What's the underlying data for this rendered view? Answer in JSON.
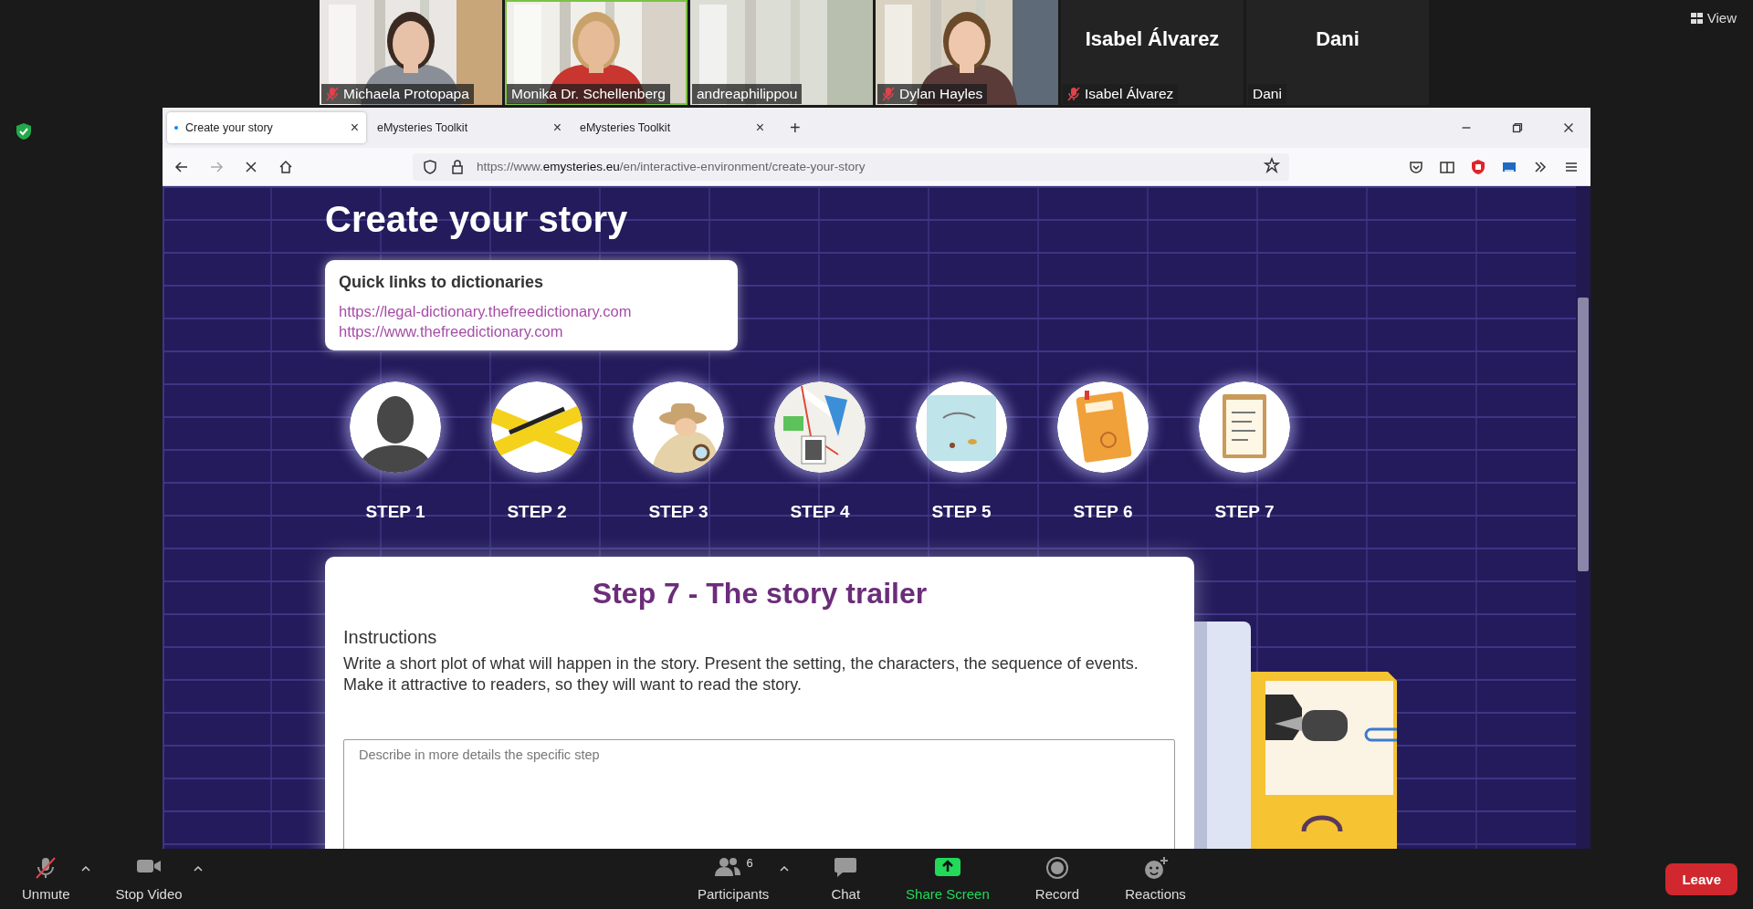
{
  "meeting": {
    "view_button": "View",
    "participants": [
      {
        "name": "Michaela Protopapa",
        "muted": true,
        "video": true,
        "speaking": false
      },
      {
        "name": "Monika Dr. Schellenberg",
        "muted": false,
        "video": true,
        "speaking": true
      },
      {
        "name": "andreaphilippou",
        "muted": false,
        "video": true,
        "speaking": false
      },
      {
        "name": "Dylan Hayles",
        "muted": true,
        "video": true,
        "speaking": false
      },
      {
        "name": "Isabel Álvarez",
        "display_name": "Isabel Álvarez",
        "muted": true,
        "video": false
      },
      {
        "name": "Dani",
        "display_name": "Dani",
        "muted": false,
        "video": false
      }
    ]
  },
  "browser": {
    "tabs": [
      {
        "label": "Create your story",
        "selected": true,
        "loading": true,
        "close": "×"
      },
      {
        "label": "eMysteries Toolkit",
        "selected": false,
        "loading": false,
        "close": "×"
      },
      {
        "label": "eMysteries Toolkit",
        "selected": false,
        "loading": false,
        "close": "×"
      }
    ],
    "new_tab": "+",
    "url": "https://www.**emysteries.eu**/en/interactive-environment/create-your-story",
    "page": {
      "title": "Create your story",
      "links_card": {
        "heading": "Quick links to dictionaries",
        "links": [
          "https://legal-dictionary.thefreedictionary.com",
          "https://www.thefreedictionary.com"
        ]
      },
      "steps": [
        {
          "label": "STEP 1"
        },
        {
          "label": "STEP 2"
        },
        {
          "label": "STEP 3"
        },
        {
          "label": "STEP 4"
        },
        {
          "label": "STEP 5"
        },
        {
          "label": "STEP 6"
        },
        {
          "label": "STEP 7"
        }
      ],
      "step_panel": {
        "title": "Step 7 - The story trailer",
        "subheading": "Instructions",
        "text": "Write a short plot of what will happen in the story. Present the setting, the characters, the sequence of events. Make it attractive to readers, so they will want to read the story.",
        "placeholder": "Describe in more details the specific step"
      }
    }
  },
  "toolbar": {
    "items": [
      {
        "kind": "mic",
        "label": "Unmute",
        "muted": true,
        "menu": true
      },
      {
        "kind": "video",
        "label": "Stop Video",
        "menu": true
      },
      {
        "kind": "participants",
        "label": "Participants",
        "count": "6",
        "menu": true
      },
      {
        "kind": "chat",
        "label": "Chat"
      },
      {
        "kind": "share",
        "label": "Share Screen"
      },
      {
        "kind": "record",
        "label": "Record"
      },
      {
        "kind": "reactions",
        "label": "Reactions"
      }
    ],
    "leave": "Leave"
  }
}
